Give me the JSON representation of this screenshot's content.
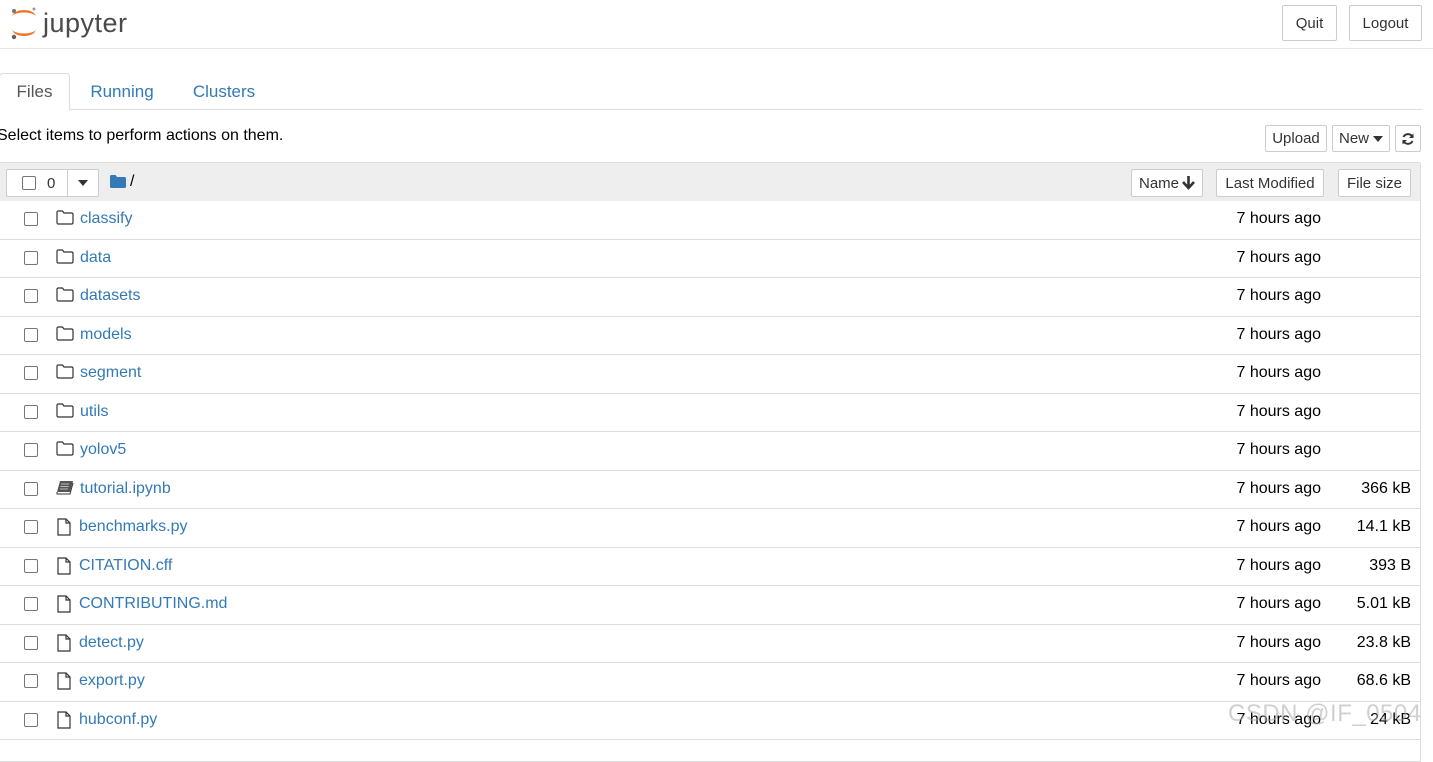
{
  "header": {
    "logo_text": "jupyter",
    "quit_label": "Quit",
    "logout_label": "Logout"
  },
  "tabs": [
    {
      "label": "Files",
      "active": true
    },
    {
      "label": "Running",
      "active": false
    },
    {
      "label": "Clusters",
      "active": false
    }
  ],
  "toolbar": {
    "hint": "Select items to perform actions on them.",
    "upload_label": "Upload",
    "new_label": "New"
  },
  "list_header": {
    "selected_count": "0",
    "breadcrumb": "/",
    "sort_name_label": "Name",
    "last_modified_label": "Last Modified",
    "file_size_label": "File size"
  },
  "items": [
    {
      "name": "classify",
      "type": "folder",
      "modified": "7 hours ago",
      "size": ""
    },
    {
      "name": "data",
      "type": "folder",
      "modified": "7 hours ago",
      "size": ""
    },
    {
      "name": "datasets",
      "type": "folder",
      "modified": "7 hours ago",
      "size": ""
    },
    {
      "name": "models",
      "type": "folder",
      "modified": "7 hours ago",
      "size": ""
    },
    {
      "name": "segment",
      "type": "folder",
      "modified": "7 hours ago",
      "size": ""
    },
    {
      "name": "utils",
      "type": "folder",
      "modified": "7 hours ago",
      "size": ""
    },
    {
      "name": "yolov5",
      "type": "folder",
      "modified": "7 hours ago",
      "size": ""
    },
    {
      "name": "tutorial.ipynb",
      "type": "notebook",
      "modified": "7 hours ago",
      "size": "366 kB"
    },
    {
      "name": "benchmarks.py",
      "type": "file",
      "modified": "7 hours ago",
      "size": "14.1 kB"
    },
    {
      "name": "CITATION.cff",
      "type": "file",
      "modified": "7 hours ago",
      "size": "393 B"
    },
    {
      "name": "CONTRIBUTING.md",
      "type": "file",
      "modified": "7 hours ago",
      "size": "5.01 kB"
    },
    {
      "name": "detect.py",
      "type": "file",
      "modified": "7 hours ago",
      "size": "23.8 kB"
    },
    {
      "name": "export.py",
      "type": "file",
      "modified": "7 hours ago",
      "size": "68.6 kB"
    },
    {
      "name": "hubconf.py",
      "type": "file",
      "modified": "7 hours ago",
      "size": "24 kB"
    }
  ],
  "watermark": "CSDN @IF_0504",
  "colors": {
    "link": "#337ab7",
    "logo_orange": "#f37626",
    "header_bg": "#eeeeee"
  }
}
